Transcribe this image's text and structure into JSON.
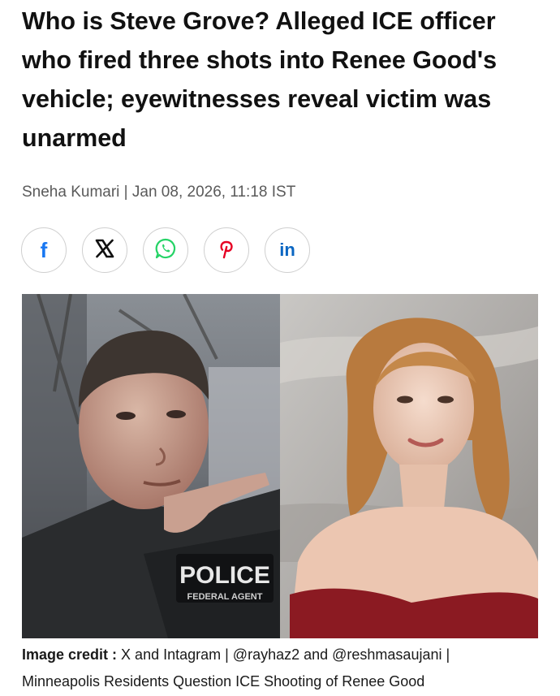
{
  "article": {
    "headline": "Who is Steve Grove? Alleged ICE officer who fired three shots into Renee Good's vehicle; eyewitnesses reveal victim was unarmed",
    "byline": "Sneha Kumari | Jan 08, 2026, 11:18 IST"
  },
  "share": {
    "buttons": [
      {
        "icon": "facebook-icon",
        "glyph": "f",
        "color": "#1877f2"
      },
      {
        "icon": "x-icon",
        "glyph": "X",
        "color": "#111111"
      },
      {
        "icon": "whatsapp-icon",
        "glyph": "",
        "color": "#25d366"
      },
      {
        "icon": "pinterest-icon",
        "glyph": "P",
        "color": "#e60023"
      },
      {
        "icon": "linkedin-icon",
        "glyph": "in",
        "color": "#0a66c2"
      }
    ]
  },
  "image": {
    "patch_text": "POLICE",
    "patch_subtext": "FEDERAL AGENT"
  },
  "caption": {
    "label": "Image credit :",
    "text_line1": " X and Intagram | @rayhaz2 and @reshmasaujani |",
    "text_line2": "Minneapolis Residents Question ICE Shooting of Renee Good"
  }
}
